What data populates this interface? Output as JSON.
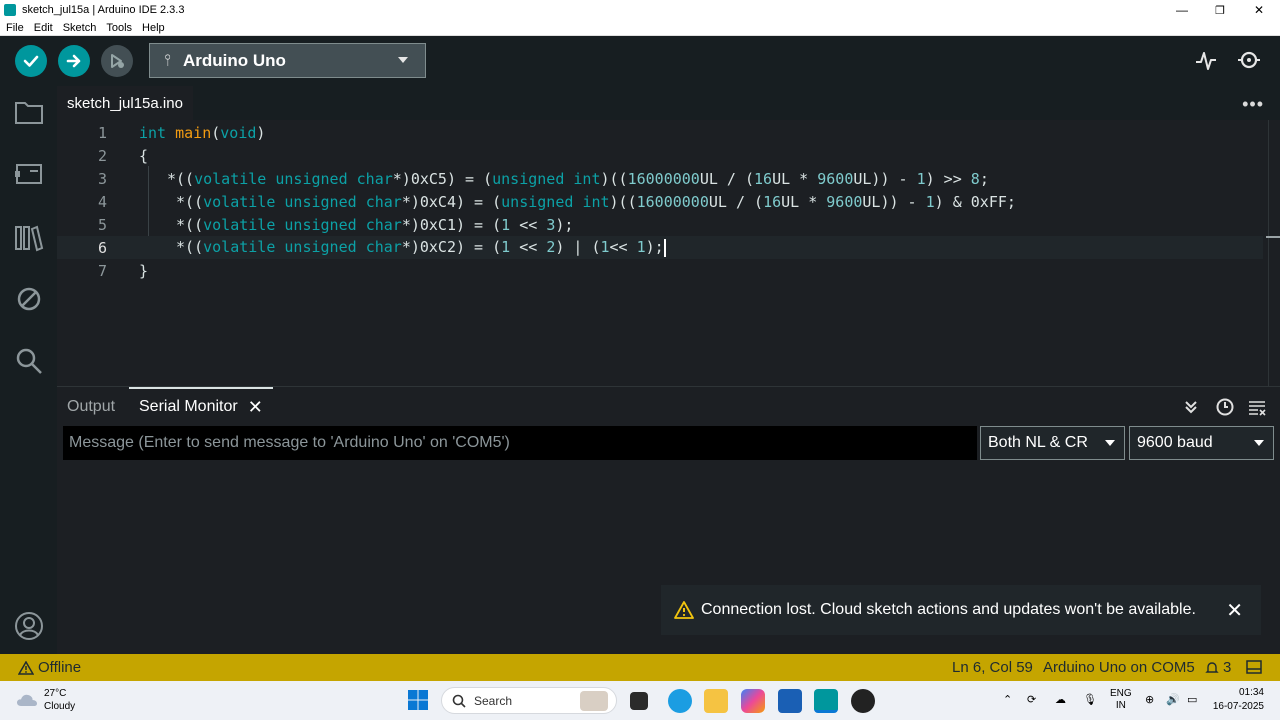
{
  "window": {
    "title": "sketch_jul15a | Arduino IDE 2.3.3",
    "minimize": "—",
    "maximize": "❐",
    "close": "✕"
  },
  "menu": [
    "File",
    "Edit",
    "Sketch",
    "Tools",
    "Help"
  ],
  "toolbar": {
    "verify_icon": "check-icon",
    "upload_icon": "arrow-right-icon",
    "debug_icon": "debug-icon",
    "board": "Arduino Uno",
    "serial_plotter_icon": "pulse-icon",
    "serial_monitor_icon": "magnifier-icon"
  },
  "sidebar": [
    "folder-icon",
    "board-manager-icon",
    "library-icon",
    "debug-ban-icon",
    "search-icon",
    "account-icon"
  ],
  "editor": {
    "file_tab": "sketch_jul15a.ino",
    "more": "•••",
    "lines": [
      {
        "n": "1",
        "text": "int main(void)"
      },
      {
        "n": "2",
        "text": "{"
      },
      {
        "n": "3",
        "text": "*((volatile unsigned char*)0xC5) = (unsigned int)((16000000UL / (16UL * 9600UL)) - 1) >> 8;"
      },
      {
        "n": "4",
        "text": " *((volatile unsigned char*)0xC4) = (unsigned int)((16000000UL / (16UL * 9600UL)) - 1) & 0xFF;"
      },
      {
        "n": "5",
        "text": " *((volatile unsigned char*)0xC1) = (1 << 3);"
      },
      {
        "n": "6",
        "text": " *((volatile unsigned char*)0xC2) = (1 << 2) | (1<< 1);"
      },
      {
        "n": "7",
        "text": "}"
      }
    ]
  },
  "panel": {
    "tab_output": "Output",
    "tab_serial": "Serial Monitor",
    "tab_close": "✕",
    "message_placeholder": "Message (Enter to send message to 'Arduino Uno' on 'COM5')",
    "line_ending": "Both NL & CR",
    "baud": "9600 baud"
  },
  "notification": {
    "message": "Connection lost. Cloud sketch actions and updates won't be available.",
    "close": "✕"
  },
  "status": {
    "offline": "Offline",
    "position": "Ln 6, Col 59",
    "board_port": "Arduino Uno on COM5",
    "notifications": "3"
  },
  "taskbar": {
    "temperature": "27°C",
    "weather": "Cloudy",
    "search": "Search",
    "lang1": "ENG",
    "lang2": "IN",
    "time": "01:34",
    "date": "16-07-2025"
  },
  "colors": {
    "accent": "#00979d",
    "status_bar": "#c5a500"
  }
}
